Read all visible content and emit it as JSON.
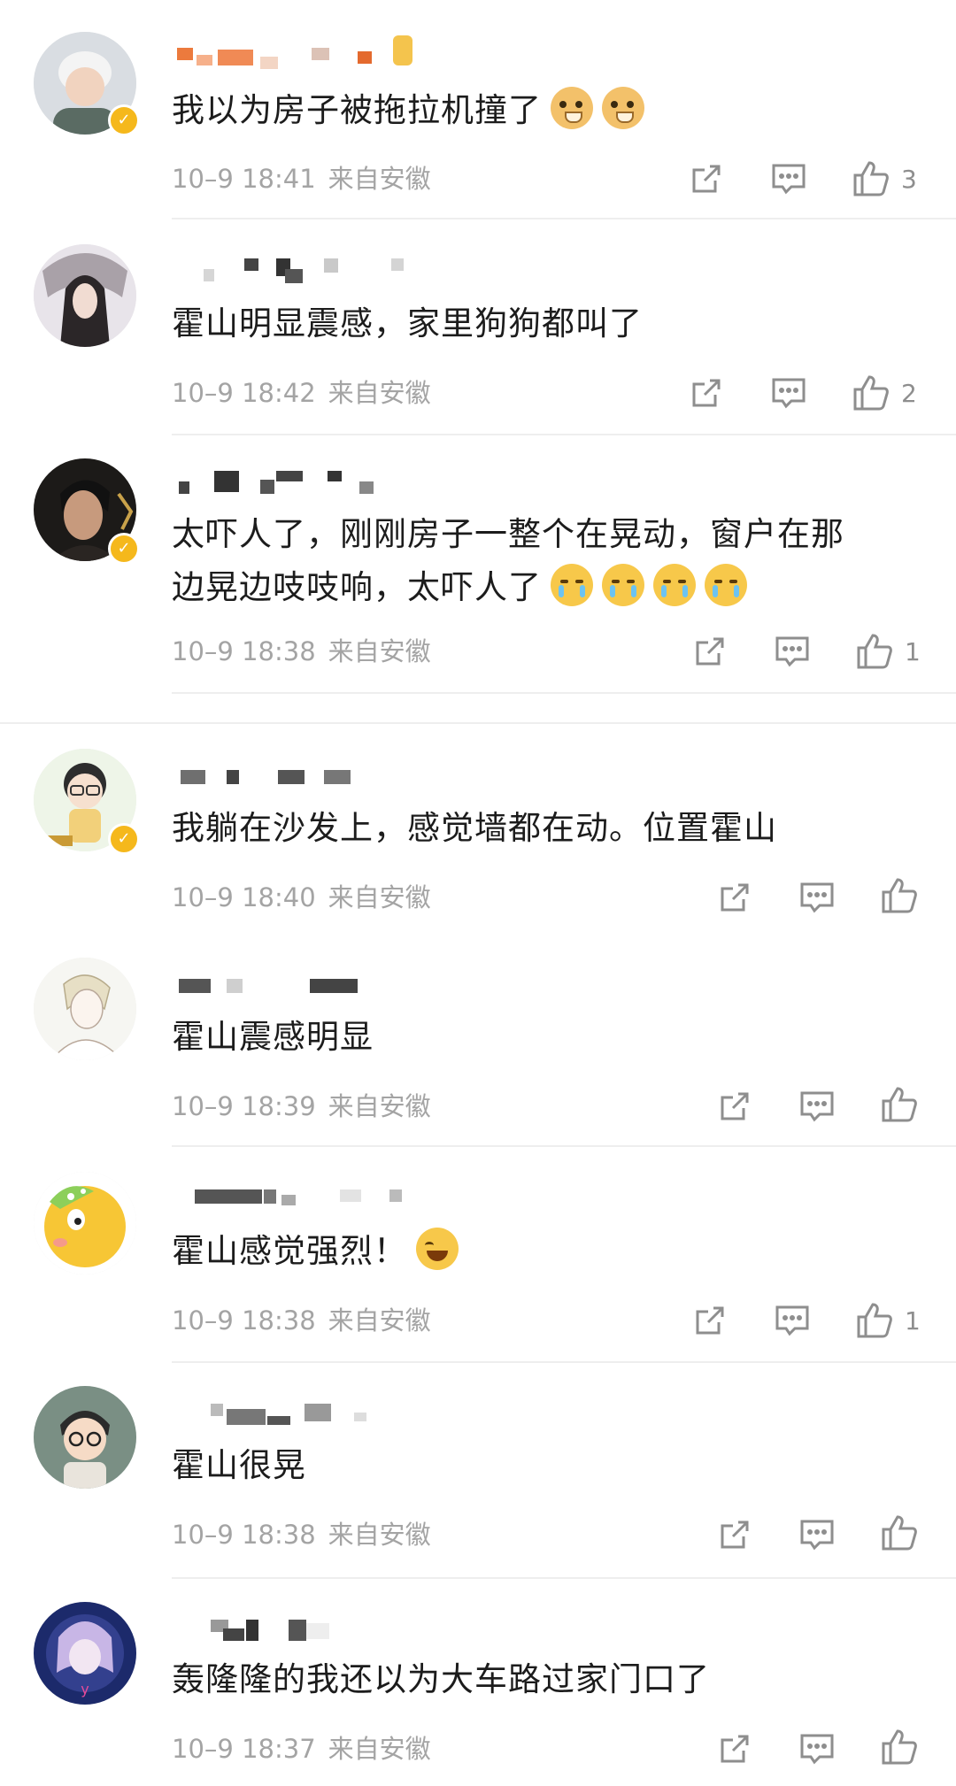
{
  "comments": [
    {
      "text": "我以为房子被拖拉机撞了",
      "emojis": [
        "doge",
        "doge"
      ],
      "time": "10–9 18:41",
      "location": "来自安徽",
      "likes": "3",
      "verified": true
    },
    {
      "text": "霍山明显震感，家里狗狗都叫了",
      "emojis": [],
      "time": "10–9 18:42",
      "location": "来自安徽",
      "likes": "2",
      "verified": false
    },
    {
      "text_line1": "太吓人了，刚刚房子一整个在晃动，窗户在那",
      "text_line2": "边晃边吱吱响，太吓人了",
      "emojis": [
        "cry",
        "cry",
        "cry",
        "cry"
      ],
      "time": "10–9 18:38",
      "location": "来自安徽",
      "likes": "1",
      "verified": true
    },
    {
      "text": "我躺在沙发上，感觉墙都在动。位置霍山",
      "emojis": [],
      "time": "10–9 18:40",
      "location": "来自安徽",
      "likes": "",
      "verified": true
    },
    {
      "text": "霍山震感明显",
      "emojis": [],
      "time": "10–9 18:39",
      "location": "来自安徽",
      "likes": "",
      "verified": false
    },
    {
      "text": "霍山感觉强烈！",
      "emojis": [
        "laugh"
      ],
      "time": "10–9 18:38",
      "location": "来自安徽",
      "likes": "1",
      "verified": false
    },
    {
      "text": "霍山很晃",
      "emojis": [],
      "time": "10–9 18:38",
      "location": "来自安徽",
      "likes": "",
      "verified": false
    },
    {
      "text": "轰隆隆的我还以为大车路过家门口了",
      "emojis": [],
      "time": "10–9 18:37",
      "location": "来自安徽",
      "likes": "",
      "verified": false
    }
  ],
  "colors": {
    "meta": "#a4a4a4",
    "badge": "#f5b81c",
    "icon": "#8e8e8e"
  },
  "icons": {
    "share": "share-icon",
    "comment": "comment-icon",
    "like": "thumbs-up-icon"
  }
}
